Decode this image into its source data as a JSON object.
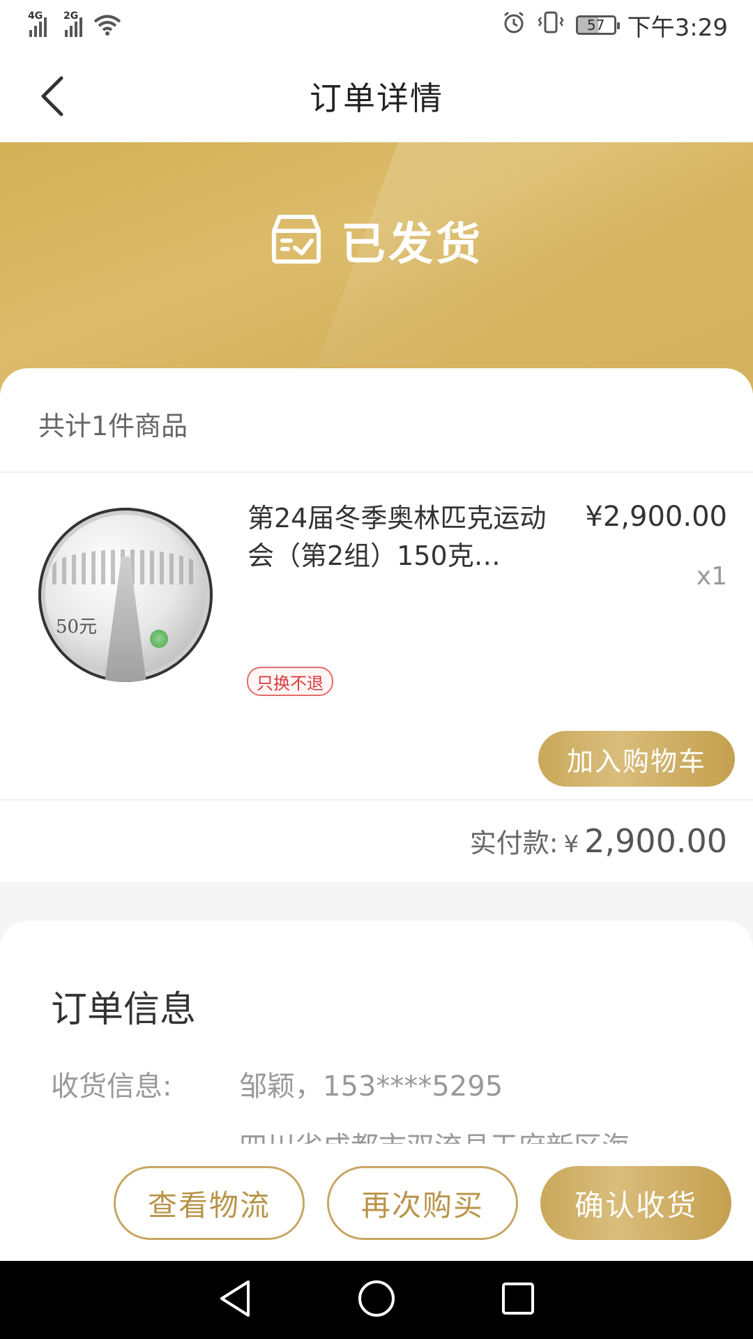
{
  "status_bar": {
    "network1": "4G",
    "network2": "2G",
    "battery": "57",
    "time": "下午3:29"
  },
  "nav": {
    "title": "订单详情",
    "back_icon": "back-chevron-icon"
  },
  "order_status": {
    "label": "已发货",
    "icon": "shipped-box-icon"
  },
  "goods": {
    "count_label": "共计1件商品",
    "item": {
      "name": "第24届冬季奥林匹克运动会（第2组）150克…",
      "price": "¥2,900.00",
      "quantity": "x1",
      "tag": "只换不退",
      "coin_denomination": "50元",
      "add_cart_label": "加入购物车"
    },
    "paid_label": "实付款:",
    "paid_currency": "¥",
    "paid_amount": "2,900.00"
  },
  "order_info": {
    "title": "订单信息",
    "receiver_label": "收货信息:",
    "receiver_value": "邹颖，153****5295",
    "address_partial": "四川省成都市双流县天府新区海"
  },
  "actions": {
    "logistics": "查看物流",
    "rebuy": "再次购买",
    "confirm": "确认收货"
  },
  "colors": {
    "gold": "#c9a85b",
    "banner": "#d4b35f",
    "tag_red": "#d93c3c"
  }
}
